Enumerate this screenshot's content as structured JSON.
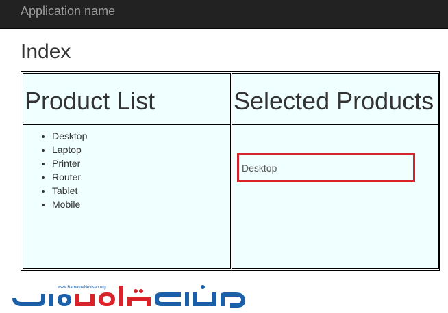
{
  "navbar": {
    "brand": "Application name"
  },
  "page": {
    "title": "Index"
  },
  "columns": {
    "left_title": "Product List",
    "right_title": "Selected Products"
  },
  "products": [
    "Desktop",
    "Laptop",
    "Printer",
    "Router",
    "Tablet",
    "Mobile"
  ],
  "selected": {
    "items": [
      "Desktop"
    ],
    "highlight_color": "#d9232a"
  },
  "logo": {
    "text": "www.BarnameNevisan.org",
    "colors": [
      "#1b5fa8",
      "#d9232a"
    ]
  }
}
